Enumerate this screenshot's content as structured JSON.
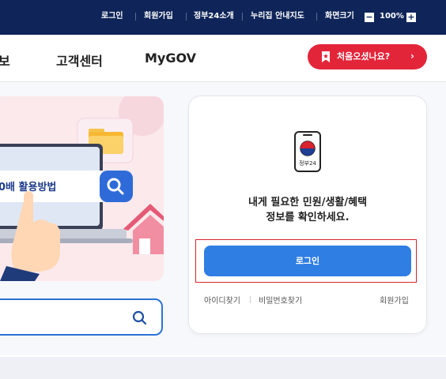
{
  "utility_bar": {
    "login": "로그인",
    "signup": "회원가입",
    "about": "정부24소개",
    "sitemap": "누리집 안내지도",
    "screen_size": "화면크기",
    "zoom_out": "−",
    "zoom_level": "100%",
    "zoom_in": "+"
  },
  "nav": {
    "item_partial": "보",
    "customer_center": "고객센터",
    "mygov": "MyGOV",
    "first_visit": "처음오셨나요?",
    "first_visit_arrow": "›"
  },
  "banner": {
    "search_text": "0배 활용방법"
  },
  "search": {
    "placeholder": ""
  },
  "login_card": {
    "app_label": "정부24",
    "message_line1": "내게 필요한 민원/생활/혜택",
    "message_line2": "정보를 확인하세요.",
    "login_button": "로그인",
    "find_id": "아이디찾기",
    "find_password": "비밀번호찾기",
    "signup": "회원가입"
  },
  "colors": {
    "top_bar": "#0f2559",
    "accent_red": "#e3253a",
    "login_blue": "#2f7ee4",
    "highlight_red": "#d9232e",
    "search_border": "#2b73d6"
  },
  "icons": [
    "bookmark-icon",
    "search-icon",
    "gov24-app-icon",
    "folder-icon",
    "house-icon",
    "pointing-hand-icon",
    "laptop-icon"
  ]
}
